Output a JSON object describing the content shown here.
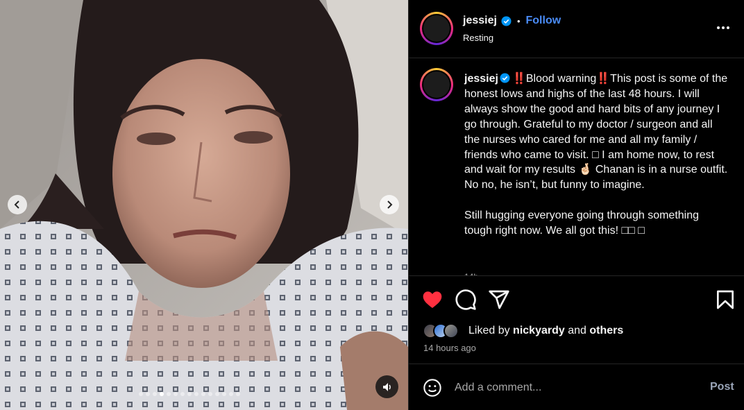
{
  "post": {
    "username": "jessiej",
    "follow_label": "Follow",
    "separator": "•",
    "location": "Resting",
    "caption_username": "jessiej",
    "caption_text": "‼️Blood warning‼️This post is some of the honest lows and highs of the last 48 hours. I will always show the good and hard bits of any journey I go through. Grateful to my doctor / surgeon and all the nurses who cared for me and all my family / friends who came to visit. □ I am home now, to rest and wait for my results 🤞🏻 Chanan is in a nurse outfit. No no, he isn’t, but funny to imagine.\n\nStill hugging everyone going through something tough right now. We all got this! □□ □",
    "caption_time": "14h",
    "liked_by_prefix": "Liked by",
    "liked_by_user": "nickyardy",
    "liked_by_and": "and",
    "liked_by_others": "others",
    "time_ago": "14 hours ago",
    "comment_placeholder": "Add a comment...",
    "post_label": "Post"
  },
  "media": {
    "slide_count": 15,
    "active_slide": 3
  },
  "icons": {
    "like": "heart-filled-icon",
    "comment": "comment-icon",
    "share": "share-icon",
    "save": "bookmark-icon",
    "emoji": "emoji-icon",
    "audio": "speaker-icon",
    "verified": "verified-badge-icon"
  },
  "colors": {
    "like": "#ff3040",
    "follow": "#4a8cf7",
    "verified": "#0095f6",
    "post_button": "#9aa5b8"
  }
}
